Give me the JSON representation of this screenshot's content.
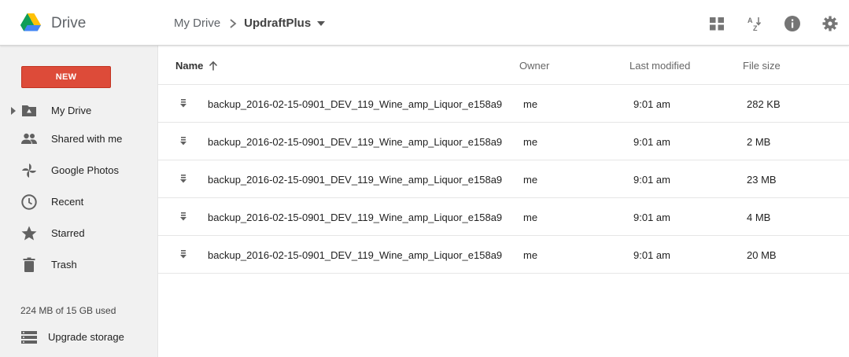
{
  "app": {
    "title": "Drive"
  },
  "breadcrumb": {
    "root": "My Drive",
    "current": "UpdraftPlus"
  },
  "header_icons": [
    "grid-view-icon",
    "sort-az-icon",
    "info-icon",
    "settings-icon"
  ],
  "sidebar": {
    "new_label": "NEW",
    "items": [
      {
        "label": "My Drive",
        "icon": "folder-drive-icon"
      },
      {
        "label": "Shared with me",
        "icon": "people-icon"
      },
      {
        "label": "Google Photos",
        "icon": "pinwheel-icon"
      },
      {
        "label": "Recent",
        "icon": "clock-icon"
      },
      {
        "label": "Starred",
        "icon": "star-icon"
      },
      {
        "label": "Trash",
        "icon": "trash-icon"
      }
    ],
    "storage_text": "224 MB of 15 GB used",
    "upgrade_label": "Upgrade storage"
  },
  "table": {
    "columns": {
      "name": "Name",
      "owner": "Owner",
      "modified": "Last modified",
      "size": "File size"
    },
    "rows": [
      {
        "name": "backup_2016-02-15-0901_DEV_119_Wine_amp_Liquor_e158a9...",
        "owner": "me",
        "modified": "9:01 am",
        "size": "282 KB"
      },
      {
        "name": "backup_2016-02-15-0901_DEV_119_Wine_amp_Liquor_e158a9...",
        "owner": "me",
        "modified": "9:01 am",
        "size": "2 MB"
      },
      {
        "name": "backup_2016-02-15-0901_DEV_119_Wine_amp_Liquor_e158a9...",
        "owner": "me",
        "modified": "9:01 am",
        "size": "23 MB"
      },
      {
        "name": "backup_2016-02-15-0901_DEV_119_Wine_amp_Liquor_e158a9...",
        "owner": "me",
        "modified": "9:01 am",
        "size": "4 MB"
      },
      {
        "name": "backup_2016-02-15-0901_DEV_119_Wine_amp_Liquor_e158a9...",
        "owner": "me",
        "modified": "9:01 am",
        "size": "20 MB"
      }
    ]
  },
  "colors": {
    "new_button": "#dd4b39",
    "icon_gray": "#757575"
  }
}
